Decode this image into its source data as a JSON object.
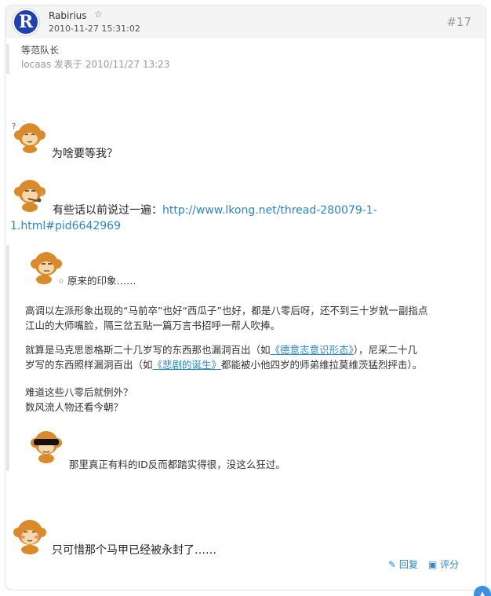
{
  "post": {
    "username": "Rabirius",
    "star_icon": "☆",
    "timestamp": "2010-11-27 15:31:02",
    "floor": "#17",
    "avatar_letter": "R"
  },
  "quote_top": {
    "title": "等范队长",
    "meta": "locaas 发表于 2010/11/27 13:23"
  },
  "body": {
    "line1": "为啥要等我？",
    "line2_text": "有些话以前说过一遍：",
    "line2_link_a": "http://www.lkong.net/thread-280079-1-",
    "line2_link_b": "1.html#pid6642969",
    "last_line": "只可惜那个马甲已经被永封了……"
  },
  "quote_box": {
    "intro": "原来的印象……",
    "p1_line1": "高调以左派形象出现的“马前卒”也好“西瓜子”也好，都是八零后呀，还不到三十岁就一副指点",
    "p1_line2": "江山的大师嘴脸，隔三岔五贴一篇万言书招呼一帮人吹捧。",
    "p2_a": "就算是马克思恩格斯二十几岁写的东西那也漏洞百出（如",
    "p2_link1": "《德意志意识形态》",
    "p2_b": "），尼采二十几",
    "p2_c": "岁写的东西照样漏洞百出（如",
    "p2_link2": "《悲剧的诞生》",
    "p2_d": "都能被小他四岁的师弟维拉莫维茨猛烈抨击）。",
    "p3_line1": "难道这些八零后就例外？",
    "p3_line2": "数风流人物还看今朝？",
    "outro": "那里真正有料的ID反而都踏实得很，没这么狂过。"
  },
  "actions": {
    "reply_label": "回复",
    "rate_label": "评分",
    "reply_icon": "✎",
    "rate_icon": "▣"
  },
  "colors": {
    "link": "#2b86c4",
    "avatar_bg": "#1f3fb3",
    "monkey": "#d98a2b"
  }
}
